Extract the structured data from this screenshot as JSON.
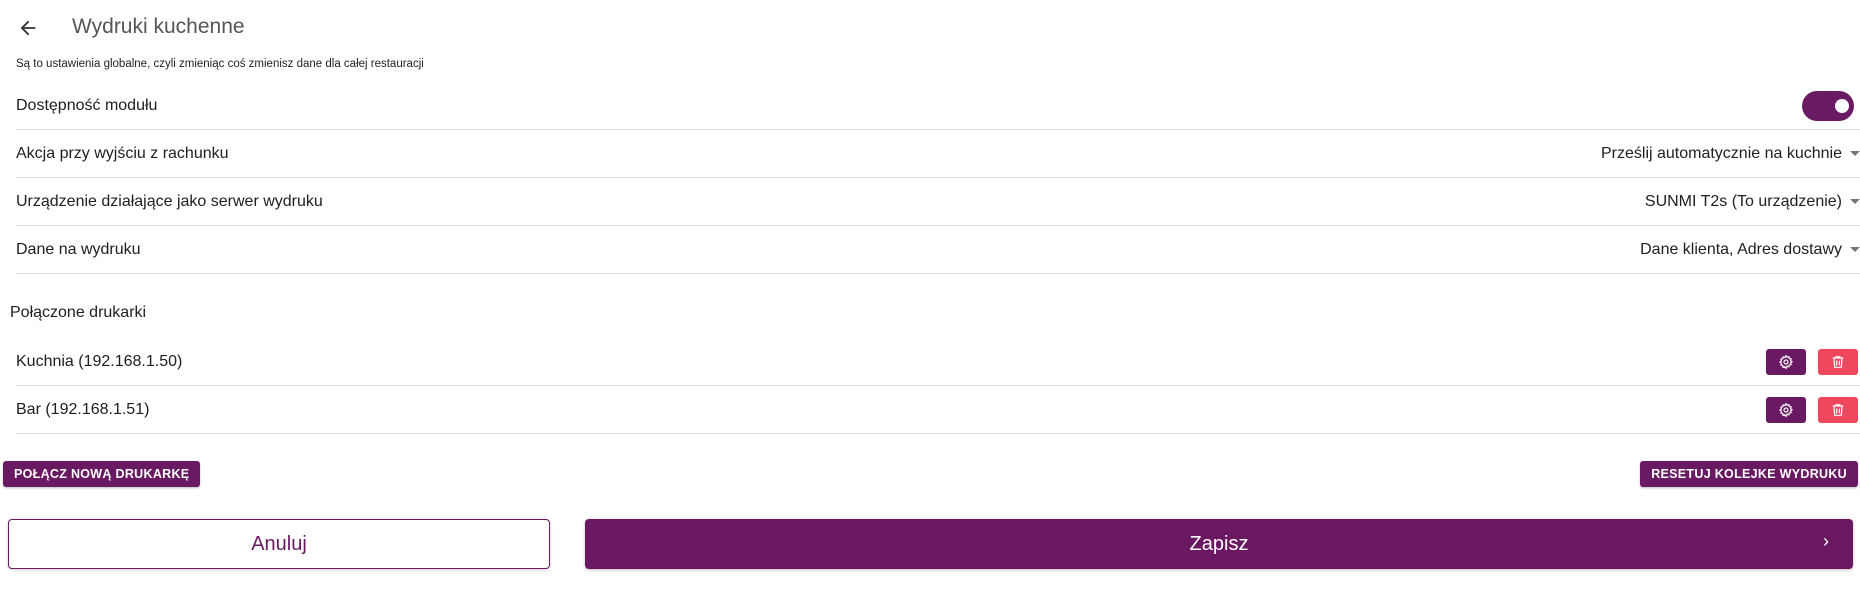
{
  "header": {
    "back_icon": "arrow-left-icon",
    "title": "Wydruki kuchenne"
  },
  "notice": "Są to ustawienia globalne, czyli zmieniąc coś zmienisz dane dla całej restauracji",
  "settings": {
    "module": {
      "label": "Dostępność modułu",
      "enabled": true
    },
    "exit_action": {
      "label": "Akcja przy wyjściu z rachunku",
      "value": "Prześlij automatycznie na kuchnie"
    },
    "server_device": {
      "label": "Urządzenie działające jako serwer wydruku",
      "value": "SUNMI T2s (To urządzenie)"
    },
    "print_data": {
      "label": "Dane na wydruku",
      "value": "Dane klienta, Adres dostawy"
    }
  },
  "printers": {
    "title": "Połączone drukarki",
    "items": [
      {
        "label": "Kuchnia (192.168.1.50)"
      },
      {
        "label": "Bar (192.168.1.51)"
      }
    ],
    "settings_icon": "gear-icon",
    "delete_icon": "trash-icon"
  },
  "actions": {
    "connect_label": "POŁĄCZ NOWĄ DRUKARKĘ",
    "reset_label": "RESETUJ KOLEJKE WYDRUKU",
    "cancel_label": "Anuluj",
    "save_label": "Zapisz",
    "save_chevron": "›"
  },
  "colors": {
    "primary": "#6a1a62",
    "danger": "#f0475f",
    "divider": "#dddddd"
  }
}
